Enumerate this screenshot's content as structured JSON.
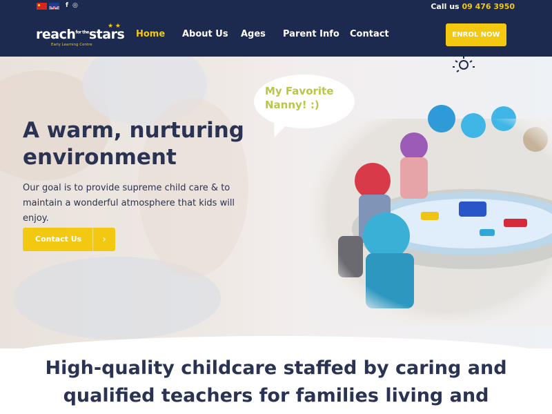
{
  "topbar": {
    "call_label": "Call us",
    "phone": "09 476 3950",
    "social": {
      "facebook": "f",
      "instagram": "◎"
    }
  },
  "header": {
    "logo": {
      "reach": "reach",
      "for_the": "for the",
      "stars": "stars",
      "subtitle": "Early Learning Centre",
      "stars_glyph": "★ ★"
    },
    "nav": [
      {
        "label": "Home",
        "active": true
      },
      {
        "label": "About Us",
        "active": false
      },
      {
        "label": "Ages",
        "active": false
      },
      {
        "label": "Parent Info",
        "active": false
      },
      {
        "label": "Contact",
        "active": false
      }
    ],
    "enrol_label": "ENROL NOW"
  },
  "hero": {
    "title": "A warm, nurturing environment",
    "text": "Our goal is to provide supreme child care & to maintain a wonderful atmosphere that kids will enjoy.",
    "button_label": "Contact Us",
    "button_icon": "chevron-right-icon",
    "bubble_text": "My Favorite Nanny! :)"
  },
  "section": {
    "heading": "High-quality childcare staffed by caring and qualified teachers for families living and"
  },
  "colors": {
    "navy": "#1b2a4e",
    "accent": "#f2c811",
    "text": "#2a3352",
    "bubble_text": "#b9c64a"
  }
}
